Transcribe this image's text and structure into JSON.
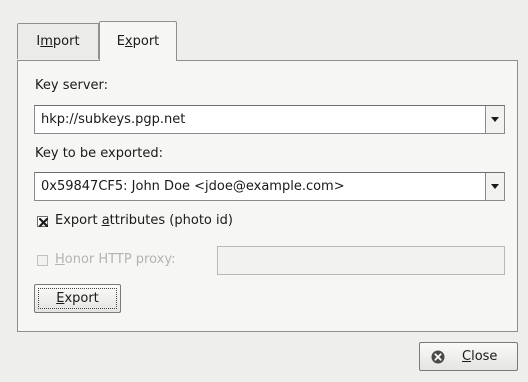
{
  "tabs": [
    {
      "label_pre": "I",
      "label_u": "m",
      "label_post": "port",
      "active": false
    },
    {
      "label_pre": "E",
      "label_u": "x",
      "label_post": "port",
      "active": true
    }
  ],
  "key_server": {
    "label": "Key server:",
    "value": "hkp://subkeys.pgp.net"
  },
  "key_to_export": {
    "label": "Key to be exported:",
    "value": "0x59847CF5: John Doe <jdoe@example.com>"
  },
  "export_attributes": {
    "label_pre": "Export ",
    "label_u": "a",
    "label_post": "ttributes (photo id)",
    "checked": true
  },
  "honor_proxy": {
    "label_pre": "",
    "label_u": "H",
    "label_post": "onor HTTP proxy:",
    "checked": false,
    "enabled": false,
    "value": ""
  },
  "export_button": {
    "label_pre": "",
    "label_u": "E",
    "label_post": "xport"
  },
  "close_button": {
    "label_pre": "",
    "label_u": "C",
    "label_post": "lose"
  }
}
